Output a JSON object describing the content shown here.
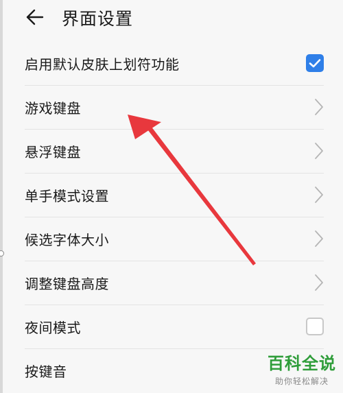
{
  "header": {
    "title": "界面设置",
    "back_icon": "arrow-left-icon"
  },
  "settings": [
    {
      "label": "启用默认皮肤上划符功能",
      "control": "checkbox",
      "checked": true
    },
    {
      "label": "游戏键盘",
      "control": "chevron"
    },
    {
      "label": "悬浮键盘",
      "control": "chevron"
    },
    {
      "label": "单手模式设置",
      "control": "chevron"
    },
    {
      "label": "候选字体大小",
      "control": "chevron"
    },
    {
      "label": "调整键盘高度",
      "control": "chevron"
    },
    {
      "label": "夜间模式",
      "control": "checkbox",
      "checked": false
    },
    {
      "label": "按键音",
      "control": "none"
    }
  ],
  "watermark": {
    "title": "百科全说",
    "subtitle": "助你轻松解决"
  },
  "colors": {
    "accent": "#2f7fe8",
    "annotation_arrow": "#e8383d",
    "watermark_green": "#2f9d3a"
  }
}
